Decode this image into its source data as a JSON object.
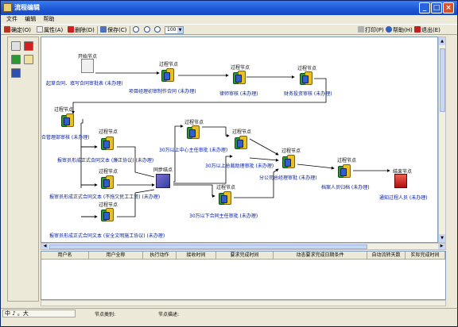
{
  "window": {
    "title": "流程编辑"
  },
  "menu": [
    {
      "label": "文件"
    },
    {
      "label": "编辑"
    },
    {
      "label": "帮助"
    }
  ],
  "toolbar": {
    "confirm": "确定(O)",
    "properties": "属性(A)",
    "delete": "删除(D)",
    "save": "保存(C)",
    "zoom": "100",
    "print": "打印(P)",
    "help": "帮助(H)",
    "exit": "退出(E)"
  },
  "flow": {
    "start": {
      "type": "开始节点",
      "desc": "起草合同、填写合同审批表 (未办理)"
    },
    "n1": {
      "type": "过程节点",
      "desc": "项目经理初审制作合同 (未办理)"
    },
    "n2": {
      "type": "过程节点",
      "desc": "律师审核 (未办理)"
    },
    "n3": {
      "type": "过程节点",
      "desc": "财务投资审核 (未办理)"
    },
    "n4": {
      "type": "过程节点",
      "desc": "合管理部审核 (未办理)"
    },
    "p1": {
      "type": "过程节点",
      "desc": "报审员形成正式合同文本 (廉正协议) (未办理)"
    },
    "p2": {
      "type": "过程节点",
      "desc": "报审员形成正式合同文本 (不拖欠民工工资) (未办理)"
    },
    "p3": {
      "type": "过程节点",
      "desc": "报审员形成正式合同文本 (安全文明施工协议) (未办理)"
    },
    "sync": {
      "type": "同步结点"
    },
    "a1": {
      "type": "过程节点",
      "desc": "30万以上中心主任审批 (未办理)"
    },
    "a2": {
      "type": "过程节点",
      "desc": "30万以上总裁助理审批 (未办理)"
    },
    "a3": {
      "type": "过程节点",
      "desc": "30万以下合同主任审批 (未办理)"
    },
    "b1": {
      "type": "过程节点",
      "desc": "分公司总经理审批 (未办理)"
    },
    "b2": {
      "type": "过程节点",
      "desc": "档案人员归档 (未办理)"
    },
    "end": {
      "type": "结束节点",
      "desc": "通知过程人员 (未办理)"
    }
  },
  "table": {
    "headers": [
      "用户名",
      "用户全称",
      "执行动作",
      "接收时间",
      "要求完成时间",
      "动态要求完成日期条件",
      "自动流转天数",
      "实际完成时间"
    ]
  },
  "status": {
    "ime": "中 ♪ 。大",
    "node_type_label": "节点类别:",
    "node_desc_label": "节点描述:"
  }
}
